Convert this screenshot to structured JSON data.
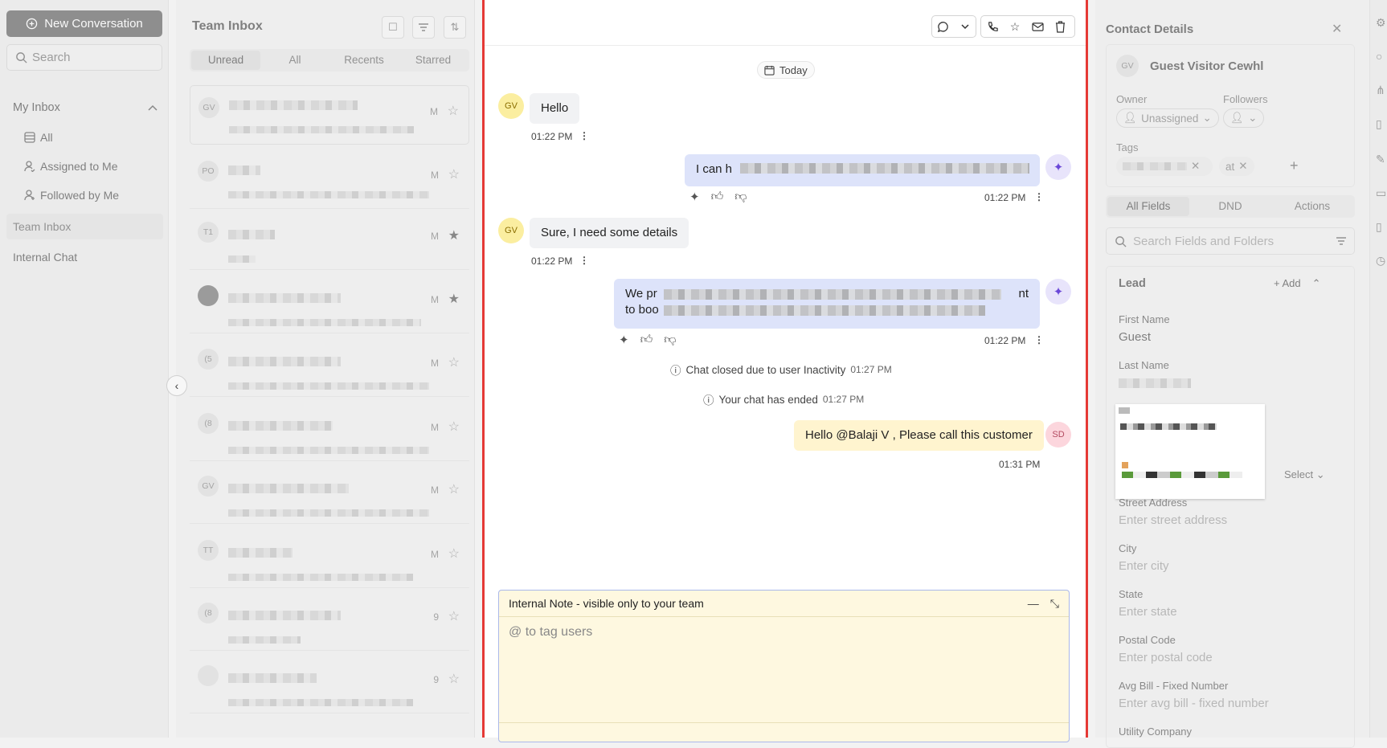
{
  "sidebar": {
    "new_conversation": "New Conversation",
    "search_placeholder": "Search",
    "my_inbox": "My Inbox",
    "items": [
      {
        "label": "All"
      },
      {
        "label": "Assigned to Me"
      },
      {
        "label": "Followed by Me"
      }
    ],
    "team_inbox": "Team Inbox",
    "internal_chat": "Internal Chat"
  },
  "list": {
    "title": "Team Inbox",
    "tabs": [
      "Unread",
      "All",
      "Recents",
      "Starred"
    ],
    "active_tab": "Unread",
    "conversations": [
      {
        "initials": "GV",
        "time": "M",
        "starred": false
      },
      {
        "initials": "PO",
        "time": "M",
        "starred": false
      },
      {
        "initials": "T1",
        "time": "M",
        "starred": true
      },
      {
        "initials": "",
        "time": "M",
        "starred": true
      },
      {
        "initials": "(5",
        "time": "M",
        "starred": false
      },
      {
        "initials": "(8",
        "time": "M",
        "starred": false
      },
      {
        "initials": "GV",
        "time": "M",
        "starred": false
      },
      {
        "initials": "TT",
        "time": "M",
        "starred": false
      },
      {
        "initials": "(8",
        "time": "9",
        "starred": false
      },
      {
        "initials": "",
        "time": "9",
        "starred": false
      }
    ]
  },
  "chat": {
    "date_chip": "Today",
    "messages": [
      {
        "dir": "in",
        "avatar": "GV",
        "text": "Hello",
        "time": "01:22 PM"
      },
      {
        "dir": "out",
        "text": "I can h",
        "time": "01:22 PM"
      },
      {
        "dir": "in",
        "avatar": "GV",
        "text": "Sure, I need some details",
        "time": "01:22 PM"
      },
      {
        "dir": "out",
        "text_line1": "We pr",
        "text_line1_end": "nt",
        "text_line2": "to boo",
        "time": "01:22 PM"
      },
      {
        "dir": "note",
        "avatar": "SD",
        "text": "Hello @Balaji V , Please call this customer",
        "time": "01:31 PM"
      }
    ],
    "system": [
      {
        "text": "Chat closed due to user Inactivity",
        "time": "01:27 PM"
      },
      {
        "text": "Your chat has ended",
        "time": "01:27 PM"
      }
    ],
    "note_box": {
      "title": "Internal Note - visible only to your team",
      "placeholder": "@ to tag users"
    }
  },
  "contact": {
    "title": "Contact Details",
    "avatar": "GV",
    "name": "Guest Visitor Cewhl",
    "owner_label": "Owner",
    "owner_value": "Unassigned",
    "followers_label": "Followers",
    "tags_label": "Tags",
    "tags": [
      "",
      "at"
    ],
    "tabs": [
      "All Fields",
      "DND",
      "Actions"
    ],
    "active_tab": "All Fields",
    "search_placeholder": "Search Fields and Folders",
    "section": "Lead",
    "add_label": "Add",
    "select_label": "Select",
    "fields": [
      {
        "label": "First Name",
        "value": "Guest"
      },
      {
        "label": "Last Name",
        "value": ""
      },
      {
        "label": "Street Address",
        "value": "Enter street address"
      },
      {
        "label": "City",
        "value": "Enter city"
      },
      {
        "label": "State",
        "value": "Enter state"
      },
      {
        "label": "Postal Code",
        "value": "Enter postal code"
      },
      {
        "label": "Avg Bill - Fixed Number",
        "value": "Enter avg bill - fixed number"
      },
      {
        "label": "Utility Company",
        "value": ""
      }
    ]
  },
  "colors": {
    "accent": "#6b48d8",
    "border_highlight": "#e53935",
    "note_bg": "#fff4cf",
    "out_bubble": "#dde3fa"
  }
}
